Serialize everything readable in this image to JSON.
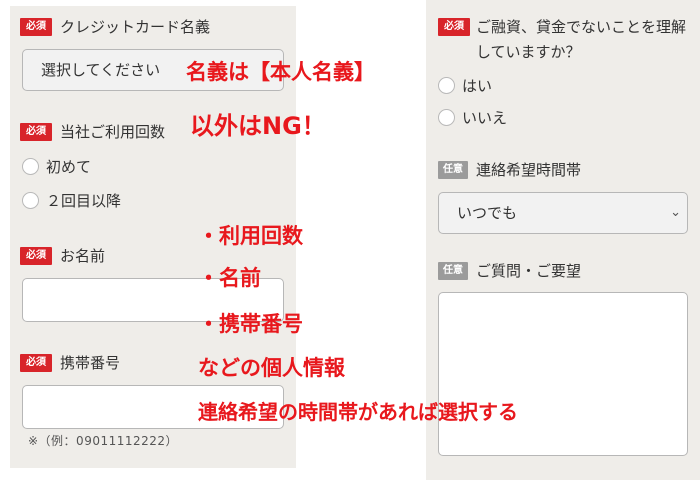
{
  "form_left": {
    "credit_card": {
      "badge": "必須",
      "label": "クレジットカード名義",
      "select_value": "選択してください"
    },
    "usage_count": {
      "badge": "必須",
      "label": "当社ご利用回数",
      "options": [
        "初めて",
        "２回目以降"
      ]
    },
    "name": {
      "badge": "必須",
      "label": "お名前",
      "value": ""
    },
    "phone": {
      "badge": "必須",
      "label": "携帯番号",
      "value": "",
      "hint": "※（例：09011112222）"
    }
  },
  "form_right": {
    "confirm": {
      "badge": "必須",
      "label_line1": "ご融資、貸金でないことを理解",
      "label_line2": "していますか？",
      "options": [
        "はい",
        "いいえ"
      ]
    },
    "contact_time": {
      "badge": "任意",
      "label": "連絡希望時間帯",
      "select_value": "いつでも"
    },
    "questions": {
      "badge": "任意",
      "label": "ご質問・ご要望",
      "value": ""
    }
  },
  "annotations": {
    "name_title": "名義は【本人名義】",
    "name_ng": "以外はNG！",
    "bullet_usage": "・利用回数",
    "bullet_name": "・名前",
    "bullet_phone": "・携帯番号",
    "personal_info": "などの個人情報",
    "contact_note": "連絡希望の時間帯があれば選択する"
  },
  "colors": {
    "panel_bg": "#efede9",
    "required_badge": "#d8242a",
    "optional_badge": "#9b9b9b",
    "annotation_red": "#e8181d"
  }
}
